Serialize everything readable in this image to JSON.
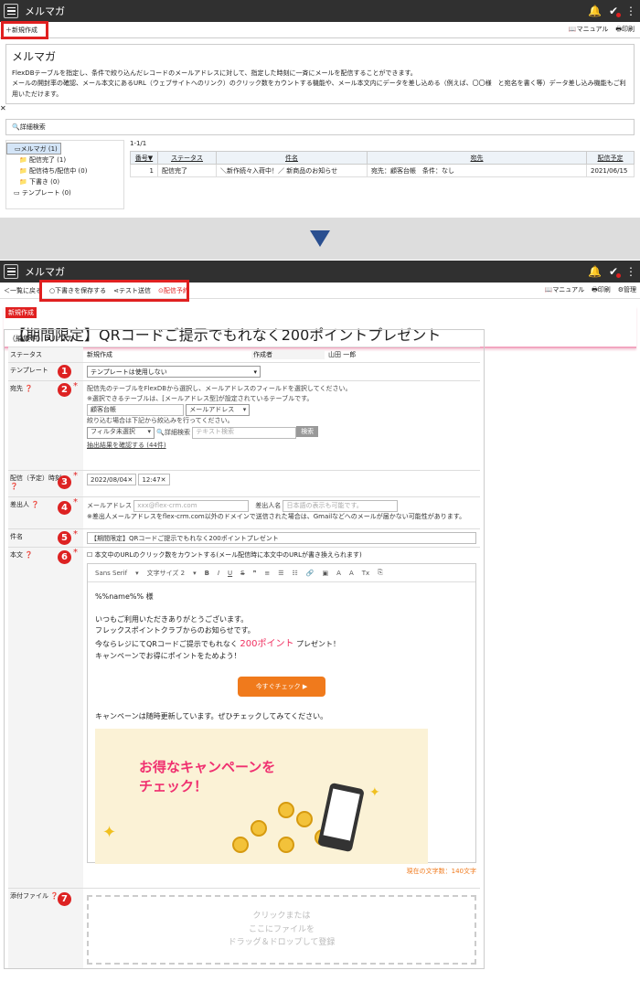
{
  "top": {
    "title": "メルマガ",
    "new_label": "新規作成",
    "manual": "マニュアル",
    "print": "印刷"
  },
  "intro": {
    "title": "メルマガ",
    "line1": "FlexDBテーブルを指定し、条件で絞り込んだレコードのメールアドレスに対して、指定した時刻に一斉にメールを配信することができます。",
    "line2": "メールの開封率の確認、メール本文にあるURL（ウェブサイトへのリンク）のクリック数をカウントする機能や、メール本文内にデータを差し込める（例えば、〇〇様　と宛名を書く等）データ差し込み機能もご利用いただけます。"
  },
  "search_label": "詳細検索",
  "tree": [
    "メルマガ (1)",
    "配信完了 (1)",
    "配信待ち/配信中 (0)",
    "下書き (0)",
    "テンプレート (0)"
  ],
  "list": {
    "count": "1-1/1",
    "headers": [
      "番号▼",
      "ステータス",
      "件名",
      "宛先",
      "配信予定"
    ],
    "row": [
      "1",
      "配信完了",
      "＼新作続々入荷中！／ 新商品のお知らせ",
      "宛先：顧客台帳　条件：なし",
      "2021/06/15"
    ]
  },
  "edit_header": {
    "title": "メルマガ",
    "back": "一覧に戻る",
    "save_draft": "下書きを保存する",
    "test_send": "テスト送信",
    "schedule": "配信予約",
    "manual": "マニュアル",
    "print": "印刷",
    "manage": "管理"
  },
  "page": {
    "badge": "新規作成",
    "title": "【期間限定】QRコードご提示でもれなく200ポイントプレゼント"
  },
  "form": {
    "heading": "（編集中）メルマガ",
    "status_label": "ステータス",
    "status_value": "新規作成",
    "author_label": "作成者",
    "author_value": "山田 一郎",
    "template_label": "テンプレート",
    "template_value": "テンプレートは使用しない",
    "dest_label": "宛先",
    "dest_note1": "配信先のテーブルをFlexDBから選択し、メールアドレスのフィールドを選択してください。",
    "dest_note2": "※選択できるテーブルは、[メールアドレス型]が設定されているテーブルです。",
    "dest_table": "顧客台帳",
    "dest_field": "メールアドレス",
    "dest_note3": "絞り込む場合は下記から絞込みを行ってください。",
    "filter": "フィルタ未選択",
    "detail": "詳細検索",
    "text_search_ph": "テキスト検索",
    "search_btn": "検索",
    "result_link": "抽出結果を確認する (44件)",
    "date_label": "配信（予定）時刻",
    "date": "2022/08/04",
    "time": "12:47",
    "sender_label": "差出人",
    "mail_label": "メールアドレス",
    "mail_ph": "xxx@flex-crm.com",
    "name_label": "差出人名",
    "name_ph": "日本語の表示も可能です。",
    "sender_note": "※差出人メールアドレスをflex-crm.com以外のドメインで送信された場合は、Gmailなどへのメールが届かない可能性があります。",
    "subject_label": "件名",
    "subject": "【期間限定】QRコードご提示でもれなく200ポイントプレゼント",
    "body_label": "本文",
    "count_check": "本文中のURLのクリック数をカウントする(メール配信時に本文中のURLが書き換えられます)",
    "font": "Sans Serif",
    "size": "文字サイズ 2",
    "body_line1": "%%name%% 様",
    "body_line2": "いつもご利用いただきありがとうございます。",
    "body_line3": "フレックスポイントクラブからのお知らせです。",
    "body_line4a": "今ならレジにてQRコードご提示でもれなく",
    "body_line4b": "200ポイント",
    "body_line4c": "プレゼント！",
    "body_line5": "キャンペーンでお得にポイントをためよう！",
    "cta": "今すぐチェック ▶",
    "body_line6": "キャンペーンは随時更新しています。ぜひチェックしてみてください。",
    "campaign_text1": "お得なキャンペーンを",
    "campaign_text2": "チェック！",
    "char_count": "現在の文字数：140文字",
    "attach_label": "添付ファイル",
    "drop1": "クリックまたは",
    "drop2": "ここにファイルを",
    "drop3": "ドラッグ＆ドロップして登録"
  },
  "colors": {
    "accent_red": "#e02020",
    "header": "#303030",
    "cta": "#f07a1c"
  }
}
